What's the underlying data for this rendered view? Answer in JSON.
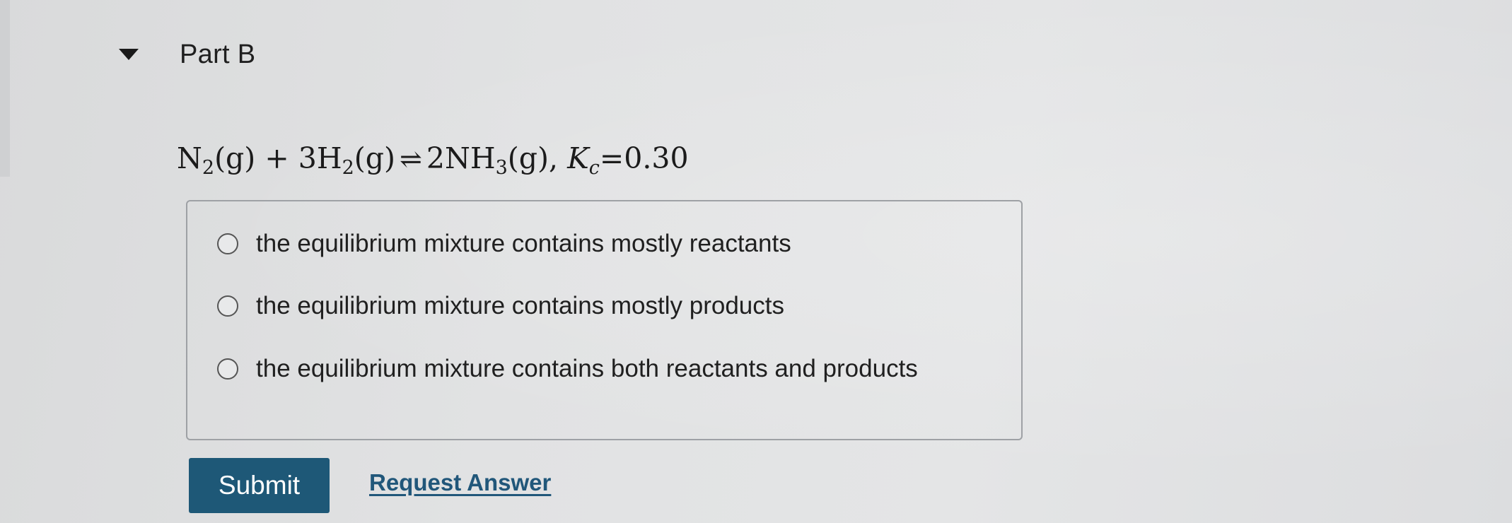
{
  "part": {
    "title": "Part B",
    "caret_icon": "caret-down-icon"
  },
  "equation": {
    "reactant1": "N",
    "reactant1_sub": "2",
    "reactant1_state": "(g)",
    "plus": "+",
    "reactant2_coef": "3H",
    "reactant2_sub": "2",
    "reactant2_state": "(g)",
    "arrow": "⇌",
    "product_coef": "2NH",
    "product_sub": "3",
    "product_state": "(g)",
    "comma": ",",
    "k_symbol": "K",
    "k_sub": "c",
    "k_value": "=0.30"
  },
  "options": [
    {
      "label": "the equilibrium mixture contains mostly reactants"
    },
    {
      "label": "the equilibrium mixture contains mostly products"
    },
    {
      "label": "the equilibrium mixture contains both reactants and products"
    }
  ],
  "actions": {
    "submit_label": "Submit",
    "request_answer_label": "Request Answer"
  },
  "colors": {
    "submit_bg": "#1e5877",
    "link": "#21577a"
  }
}
